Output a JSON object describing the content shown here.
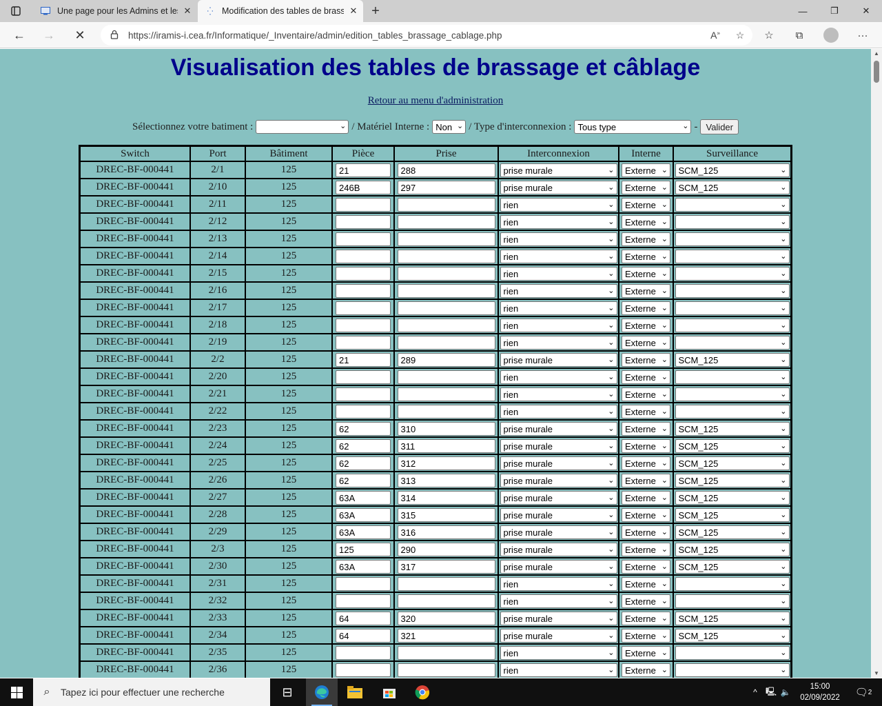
{
  "browser": {
    "tabs": [
      {
        "title": "Une page pour les Admins et les",
        "active": false
      },
      {
        "title": "Modification des tables de brass",
        "active": true
      }
    ],
    "url": "https://iramis-i.cea.fr/Informatique/_Inventaire/admin/edition_tables_brassage_cablage.php"
  },
  "page": {
    "title": "Visualisation des tables de brassage et câblage",
    "back_link": "Retour au menu d'administration",
    "filters": {
      "batiment_label": "Sélectionnez votre batiment :",
      "batiment_value": "",
      "sep1": "/ Matériel Interne :",
      "interne_value": "Non",
      "sep2": "/ Type d'interconnexion :",
      "type_value": "Tous type",
      "sep3": "-",
      "submit": "Valider"
    },
    "table": {
      "headers": [
        "Switch",
        "Port",
        "Bâtiment",
        "Pièce",
        "Prise",
        "Interconnexion",
        "Interne",
        "Surveillance"
      ],
      "rows": [
        {
          "switch": "DREC-BF-000441",
          "port": "2/1",
          "bat": "125",
          "piece": "21",
          "prise": "288",
          "inter": "prise murale",
          "interne": "Externe",
          "surv": "SCM_125"
        },
        {
          "switch": "DREC-BF-000441",
          "port": "2/10",
          "bat": "125",
          "piece": "246B",
          "prise": "297",
          "inter": "prise murale",
          "interne": "Externe",
          "surv": "SCM_125"
        },
        {
          "switch": "DREC-BF-000441",
          "port": "2/11",
          "bat": "125",
          "piece": "",
          "prise": "",
          "inter": "rien",
          "interne": "Externe",
          "surv": ""
        },
        {
          "switch": "DREC-BF-000441",
          "port": "2/12",
          "bat": "125",
          "piece": "",
          "prise": "",
          "inter": "rien",
          "interne": "Externe",
          "surv": ""
        },
        {
          "switch": "DREC-BF-000441",
          "port": "2/13",
          "bat": "125",
          "piece": "",
          "prise": "",
          "inter": "rien",
          "interne": "Externe",
          "surv": ""
        },
        {
          "switch": "DREC-BF-000441",
          "port": "2/14",
          "bat": "125",
          "piece": "",
          "prise": "",
          "inter": "rien",
          "interne": "Externe",
          "surv": ""
        },
        {
          "switch": "DREC-BF-000441",
          "port": "2/15",
          "bat": "125",
          "piece": "",
          "prise": "",
          "inter": "rien",
          "interne": "Externe",
          "surv": ""
        },
        {
          "switch": "DREC-BF-000441",
          "port": "2/16",
          "bat": "125",
          "piece": "",
          "prise": "",
          "inter": "rien",
          "interne": "Externe",
          "surv": ""
        },
        {
          "switch": "DREC-BF-000441",
          "port": "2/17",
          "bat": "125",
          "piece": "",
          "prise": "",
          "inter": "rien",
          "interne": "Externe",
          "surv": ""
        },
        {
          "switch": "DREC-BF-000441",
          "port": "2/18",
          "bat": "125",
          "piece": "",
          "prise": "",
          "inter": "rien",
          "interne": "Externe",
          "surv": ""
        },
        {
          "switch": "DREC-BF-000441",
          "port": "2/19",
          "bat": "125",
          "piece": "",
          "prise": "",
          "inter": "rien",
          "interne": "Externe",
          "surv": ""
        },
        {
          "switch": "DREC-BF-000441",
          "port": "2/2",
          "bat": "125",
          "piece": "21",
          "prise": "289",
          "inter": "prise murale",
          "interne": "Externe",
          "surv": "SCM_125"
        },
        {
          "switch": "DREC-BF-000441",
          "port": "2/20",
          "bat": "125",
          "piece": "",
          "prise": "",
          "inter": "rien",
          "interne": "Externe",
          "surv": ""
        },
        {
          "switch": "DREC-BF-000441",
          "port": "2/21",
          "bat": "125",
          "piece": "",
          "prise": "",
          "inter": "rien",
          "interne": "Externe",
          "surv": ""
        },
        {
          "switch": "DREC-BF-000441",
          "port": "2/22",
          "bat": "125",
          "piece": "",
          "prise": "",
          "inter": "rien",
          "interne": "Externe",
          "surv": ""
        },
        {
          "switch": "DREC-BF-000441",
          "port": "2/23",
          "bat": "125",
          "piece": "62",
          "prise": "310",
          "inter": "prise murale",
          "interne": "Externe",
          "surv": "SCM_125"
        },
        {
          "switch": "DREC-BF-000441",
          "port": "2/24",
          "bat": "125",
          "piece": "62",
          "prise": "311",
          "inter": "prise murale",
          "interne": "Externe",
          "surv": "SCM_125"
        },
        {
          "switch": "DREC-BF-000441",
          "port": "2/25",
          "bat": "125",
          "piece": "62",
          "prise": "312",
          "inter": "prise murale",
          "interne": "Externe",
          "surv": "SCM_125"
        },
        {
          "switch": "DREC-BF-000441",
          "port": "2/26",
          "bat": "125",
          "piece": "62",
          "prise": "313",
          "inter": "prise murale",
          "interne": "Externe",
          "surv": "SCM_125"
        },
        {
          "switch": "DREC-BF-000441",
          "port": "2/27",
          "bat": "125",
          "piece": "63A",
          "prise": "314",
          "inter": "prise murale",
          "interne": "Externe",
          "surv": "SCM_125"
        },
        {
          "switch": "DREC-BF-000441",
          "port": "2/28",
          "bat": "125",
          "piece": "63A",
          "prise": "315",
          "inter": "prise murale",
          "interne": "Externe",
          "surv": "SCM_125"
        },
        {
          "switch": "DREC-BF-000441",
          "port": "2/29",
          "bat": "125",
          "piece": "63A",
          "prise": "316",
          "inter": "prise murale",
          "interne": "Externe",
          "surv": "SCM_125"
        },
        {
          "switch": "DREC-BF-000441",
          "port": "2/3",
          "bat": "125",
          "piece": "125",
          "prise": "290",
          "inter": "prise murale",
          "interne": "Externe",
          "surv": "SCM_125"
        },
        {
          "switch": "DREC-BF-000441",
          "port": "2/30",
          "bat": "125",
          "piece": "63A",
          "prise": "317",
          "inter": "prise murale",
          "interne": "Externe",
          "surv": "SCM_125"
        },
        {
          "switch": "DREC-BF-000441",
          "port": "2/31",
          "bat": "125",
          "piece": "",
          "prise": "",
          "inter": "rien",
          "interne": "Externe",
          "surv": ""
        },
        {
          "switch": "DREC-BF-000441",
          "port": "2/32",
          "bat": "125",
          "piece": "",
          "prise": "",
          "inter": "rien",
          "interne": "Externe",
          "surv": ""
        },
        {
          "switch": "DREC-BF-000441",
          "port": "2/33",
          "bat": "125",
          "piece": "64",
          "prise": "320",
          "inter": "prise murale",
          "interne": "Externe",
          "surv": "SCM_125"
        },
        {
          "switch": "DREC-BF-000441",
          "port": "2/34",
          "bat": "125",
          "piece": "64",
          "prise": "321",
          "inter": "prise murale",
          "interne": "Externe",
          "surv": "SCM_125"
        },
        {
          "switch": "DREC-BF-000441",
          "port": "2/35",
          "bat": "125",
          "piece": "",
          "prise": "",
          "inter": "rien",
          "interne": "Externe",
          "surv": ""
        },
        {
          "switch": "DREC-BF-000441",
          "port": "2/36",
          "bat": "125",
          "piece": "",
          "prise": "",
          "inter": "rien",
          "interne": "Externe",
          "surv": ""
        }
      ]
    }
  },
  "taskbar": {
    "search_placeholder": "Tapez ici pour effectuer une recherche",
    "time": "15:00",
    "date": "02/09/2022",
    "notifications": "2"
  },
  "icons": {
    "tab_actions": "tab-actions-icon",
    "back": "back-arrow-icon",
    "forward": "forward-arrow-icon",
    "stop": "stop-loading-icon",
    "lock": "lock-icon",
    "read_aloud": "read-aloud-icon",
    "add_favorite": "add-favorite-icon",
    "favorites": "favorites-icon",
    "collections": "collections-icon",
    "profile": "profile-icon",
    "more": "more-icon"
  },
  "colors": {
    "page_background": "#87c1c1",
    "title": "#00008b",
    "taskbar": "#101010"
  }
}
